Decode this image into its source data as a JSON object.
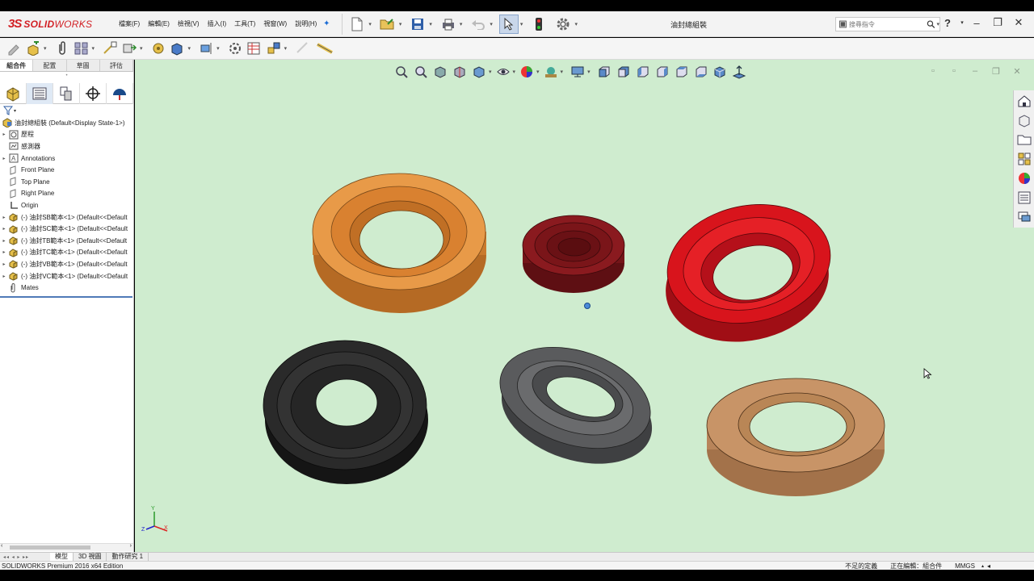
{
  "app": {
    "logo_ds": "3S",
    "logo_solid": "SOLID",
    "logo_works": "WORKS",
    "document_title": "油封總組裝"
  },
  "menu": [
    "檔案(F)",
    "編輯(E)",
    "檢視(V)",
    "插入(I)",
    "工具(T)",
    "視窗(W)",
    "說明(H)"
  ],
  "search": {
    "placeholder": "搜尋指令"
  },
  "panel_tabs": [
    "組合件",
    "配置",
    "草圖",
    "評估"
  ],
  "tree": {
    "root": "油封總組裝 (Default<Display State-1>)",
    "items": [
      {
        "label": "歷程",
        "icon": "history-icon",
        "expandable": true
      },
      {
        "label": "感測器",
        "icon": "sensor-icon",
        "expandable": false
      },
      {
        "label": "Annotations",
        "icon": "annotations-icon",
        "expandable": true
      },
      {
        "label": "Front Plane",
        "icon": "plane-icon",
        "expandable": false
      },
      {
        "label": "Top Plane",
        "icon": "plane-icon",
        "expandable": false
      },
      {
        "label": "Right Plane",
        "icon": "plane-icon",
        "expandable": false
      },
      {
        "label": "Origin",
        "icon": "origin-icon",
        "expandable": false
      },
      {
        "label": "(-) 油封SB範本<1> (Default<<Default",
        "icon": "part-icon",
        "expandable": true
      },
      {
        "label": "(-) 油封SC範本<1> (Default<<Default",
        "icon": "part-icon",
        "expandable": true
      },
      {
        "label": "(-) 油封TB範本<1> (Default<<Default",
        "icon": "part-icon",
        "expandable": true
      },
      {
        "label": "(-) 油封TC範本<1> (Default<<Default",
        "icon": "part-icon",
        "expandable": true
      },
      {
        "label": "(-) 油封VB範本<1> (Default<<Default",
        "icon": "part-icon",
        "expandable": true
      },
      {
        "label": "(-) 油封VC範本<1> (Default<<Default",
        "icon": "part-icon",
        "expandable": true
      },
      {
        "label": "Mates",
        "icon": "mates-icon",
        "expandable": false
      }
    ]
  },
  "bottom_tabs": [
    "模型",
    "3D 視圖",
    "動作研究 1"
  ],
  "status": {
    "left": "SOLIDWORKS Premium 2016 x64 Edition",
    "definition": "不足的定義",
    "editing": "正在編輯：組合件",
    "units": "MMGS"
  },
  "colors": {
    "viewport_bg": "#cfeccf",
    "brand_red": "#d21f24",
    "seal_orange": "#e08a35",
    "seal_darkred": "#8a1a1f",
    "seal_red": "#d8141c",
    "seal_black": "#2a2a2a",
    "seal_gray": "#5a5b5d",
    "seal_tan": "#c89467"
  },
  "seals": [
    {
      "name": "orange-oil-seal",
      "color": "#e08a35"
    },
    {
      "name": "darkred-oil-seal",
      "color": "#8a1a1f"
    },
    {
      "name": "red-oil-seal",
      "color": "#d8141c"
    },
    {
      "name": "black-oil-seal",
      "color": "#2a2a2a"
    },
    {
      "name": "gray-oil-seal",
      "color": "#5a5b5d"
    },
    {
      "name": "tan-oil-seal",
      "color": "#c89467"
    }
  ]
}
